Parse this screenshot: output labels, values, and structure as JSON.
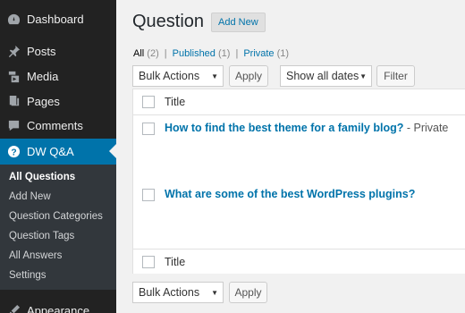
{
  "sidebar": {
    "items": [
      {
        "label": "Dashboard",
        "icon": "dashboard-icon"
      },
      {
        "label": "Posts",
        "icon": "pin-icon"
      },
      {
        "label": "Media",
        "icon": "media-icon"
      },
      {
        "label": "Pages",
        "icon": "pages-icon"
      },
      {
        "label": "Comments",
        "icon": "comments-icon"
      },
      {
        "label": "DW Q&A",
        "icon": "question-icon"
      },
      {
        "label": "Appearance",
        "icon": "appearance-icon"
      }
    ],
    "submenu": [
      "All Questions",
      "Add New",
      "Question Categories",
      "Question Tags",
      "All Answers",
      "Settings"
    ]
  },
  "page": {
    "title": "Question",
    "add_new": "Add New"
  },
  "filters": {
    "all": "All",
    "all_count": "(2)",
    "sep1": "|",
    "published": "Published",
    "published_count": "(1)",
    "sep2": "|",
    "private": "Private",
    "private_count": "(1)"
  },
  "toolbar": {
    "bulk_actions": "Bulk Actions",
    "apply": "Apply",
    "dates": "Show all dates",
    "filter": "Filter"
  },
  "table": {
    "header": "Title",
    "footer": "Title",
    "rows": [
      {
        "title": "How to find the best theme for a family blog?",
        "state": " - Private"
      },
      {
        "title": "What are some of the best WordPress plugins?",
        "state": ""
      }
    ]
  },
  "colors": {
    "accent": "#0073aa",
    "sidebar": "#222222",
    "submenu": "#32373c"
  }
}
